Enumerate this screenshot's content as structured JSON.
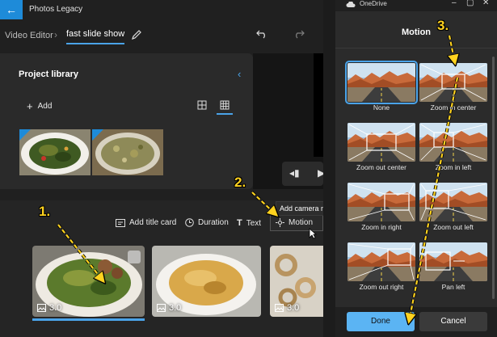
{
  "app": {
    "title": "Photos Legacy",
    "breadcrumb_root": "Video Editor",
    "breadcrumb_sep": "›",
    "breadcrumb_current": "fast slide show"
  },
  "library": {
    "title": "Project library",
    "add_label": "Add"
  },
  "toolbar": {
    "add_title_card": "Add title card",
    "duration": "Duration",
    "text": "Text",
    "motion": "Motion",
    "tooltip": "Add camera m"
  },
  "clips": [
    {
      "duration": "3.0"
    },
    {
      "duration": "3.0"
    },
    {
      "duration": "3.0"
    }
  ],
  "dialog": {
    "app_name": "OneDrive",
    "title": "Motion",
    "options": [
      "None",
      "Zoom in center",
      "Zoom out center",
      "Zoom in left",
      "Zoom in right",
      "Zoom out left",
      "Zoom out right",
      "Pan left"
    ],
    "selected": "None",
    "done_label": "Done",
    "cancel_label": "Cancel"
  },
  "annotations": {
    "step1": "1.",
    "step2": "2.",
    "step3": "3."
  },
  "colors": {
    "accent": "#4aa3e8",
    "annotation": "#ffd21f",
    "done_button": "#5bb4f3"
  }
}
